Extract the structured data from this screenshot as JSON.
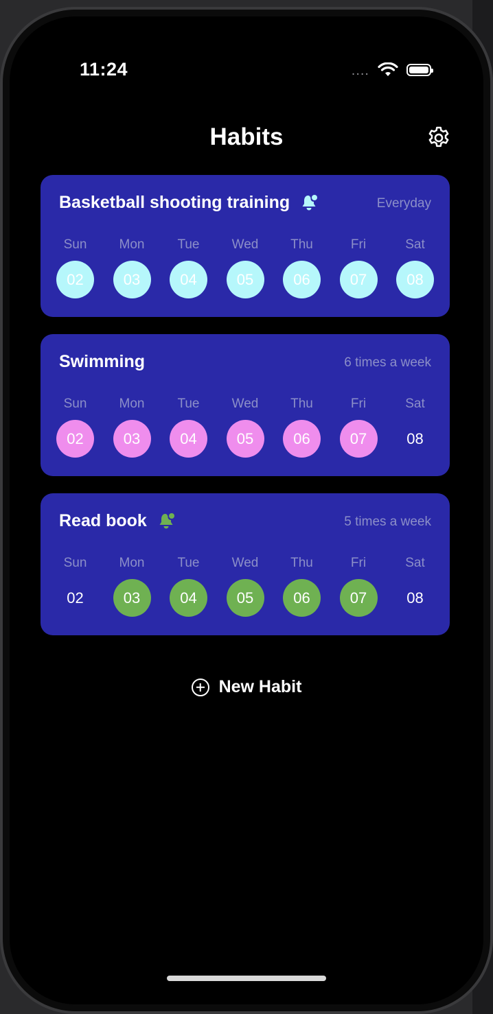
{
  "status_bar": {
    "time": "11:24",
    "signal": "....",
    "wifi_icon": "wifi-icon",
    "battery_icon": "battery-icon"
  },
  "header": {
    "title": "Habits",
    "settings_icon": "gear-icon"
  },
  "habits": [
    {
      "name": "Basketball shooting training",
      "reminder": true,
      "frequency": "Everyday",
      "color": "#b6f7fb",
      "days": [
        {
          "label": "Sun",
          "date": "02",
          "done": true
        },
        {
          "label": "Mon",
          "date": "03",
          "done": true
        },
        {
          "label": "Tue",
          "date": "04",
          "done": true
        },
        {
          "label": "Wed",
          "date": "05",
          "done": true
        },
        {
          "label": "Thu",
          "date": "06",
          "done": true
        },
        {
          "label": "Fri",
          "date": "07",
          "done": true
        },
        {
          "label": "Sat",
          "date": "08",
          "done": true
        }
      ]
    },
    {
      "name": "Swimming",
      "reminder": false,
      "frequency": "6 times a week",
      "color": "#ef8ded",
      "days": [
        {
          "label": "Sun",
          "date": "02",
          "done": true
        },
        {
          "label": "Mon",
          "date": "03",
          "done": true
        },
        {
          "label": "Tue",
          "date": "04",
          "done": true
        },
        {
          "label": "Wed",
          "date": "05",
          "done": true
        },
        {
          "label": "Thu",
          "date": "06",
          "done": true
        },
        {
          "label": "Fri",
          "date": "07",
          "done": true
        },
        {
          "label": "Sat",
          "date": "08",
          "done": false
        }
      ]
    },
    {
      "name": "Read book",
      "reminder": true,
      "frequency": "5 times a week",
      "color": "#6fb152",
      "days": [
        {
          "label": "Sun",
          "date": "02",
          "done": false
        },
        {
          "label": "Mon",
          "date": "03",
          "done": true
        },
        {
          "label": "Tue",
          "date": "04",
          "done": true
        },
        {
          "label": "Wed",
          "date": "05",
          "done": true
        },
        {
          "label": "Thu",
          "date": "06",
          "done": true
        },
        {
          "label": "Fri",
          "date": "07",
          "done": true
        },
        {
          "label": "Sat",
          "date": "08",
          "done": false
        }
      ]
    }
  ],
  "new_habit": {
    "label": "New Habit",
    "icon": "plus-circle-icon"
  }
}
